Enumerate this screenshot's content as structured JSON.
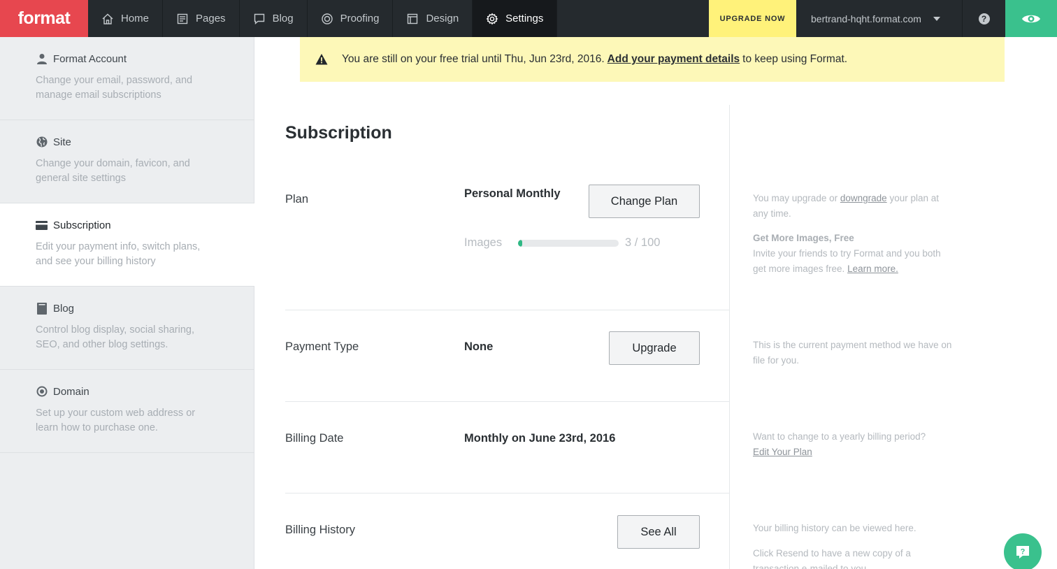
{
  "nav": {
    "logo": "format",
    "items": [
      {
        "label": "Home",
        "icon": "home-icon"
      },
      {
        "label": "Pages",
        "icon": "pages-icon"
      },
      {
        "label": "Blog",
        "icon": "blog-icon"
      },
      {
        "label": "Proofing",
        "icon": "proofing-icon"
      },
      {
        "label": "Design",
        "icon": "design-icon"
      },
      {
        "label": "Settings",
        "icon": "gear-icon",
        "active": true
      }
    ],
    "upgrade_label": "UPGRADE NOW",
    "site_name": "bertrand-hqht.format.com",
    "help_glyph": "?",
    "accent_red": "#e7474f",
    "accent_green": "#3ac18d",
    "accent_yellow": "#fff27a"
  },
  "sidebar": {
    "items": [
      {
        "title": "Format Account",
        "icon": "user-icon",
        "desc": "Change your email, password, and manage email subscriptions"
      },
      {
        "title": "Site",
        "icon": "globe-icon",
        "desc": "Change your domain, favicon, and general site settings"
      },
      {
        "title": "Subscription",
        "icon": "credit-card-icon",
        "desc": "Edit your payment info, switch plans, and see your billing history",
        "active": true
      },
      {
        "title": "Blog",
        "icon": "book-icon",
        "desc": "Control blog display, social sharing, SEO, and other blog settings."
      },
      {
        "title": "Domain",
        "icon": "target-icon",
        "desc": "Set up your custom web address or learn how to purchase one."
      }
    ]
  },
  "alert": {
    "before": "You are still on your free trial until Thu, Jun 23rd, 2016.",
    "link": "Add your payment details",
    "after": "to keep using Format."
  },
  "main": {
    "title": "Subscription",
    "plan": {
      "label": "Plan",
      "value": "Personal Monthly",
      "button": "Change Plan",
      "images_label": "Images",
      "images_count": "3 / 100",
      "images_used_fraction": 0.03
    },
    "payment": {
      "label": "Payment Type",
      "value": "None",
      "button": "Upgrade"
    },
    "billing_date": {
      "label": "Billing Date",
      "value": "Monthly on June 23rd, 2016"
    },
    "billing_history": {
      "label": "Billing History",
      "button": "See All"
    }
  },
  "help": {
    "plan_before": "You may upgrade or",
    "plan_link": "downgrade",
    "plan_after": "your plan at any time.",
    "images_title": "Get More Images, Free",
    "images_text": "Invite your friends to try Format and you both get more images free.",
    "images_link": "Learn more.",
    "payment_text": "This is the current payment method we have on file for you.",
    "billing_date_text": "Want to change to a yearly billing period?",
    "billing_date_link": "Edit Your Plan",
    "history_text1": "Your billing history can be viewed here.",
    "history_text2": "Click Resend to have a new copy of a transaction e-mailed to you."
  }
}
